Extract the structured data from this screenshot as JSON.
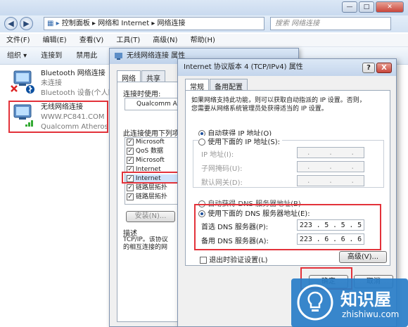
{
  "explorer": {
    "address": {
      "segments": [
        "控制面板",
        "网络和 Internet",
        "网络连接"
      ],
      "separator": "▸"
    },
    "search_placeholder": "搜索 网络连接",
    "menu": [
      "文件(F)",
      "编辑(E)",
      "查看(V)",
      "工具(T)",
      "高级(N)",
      "帮助(H)"
    ],
    "toolbar": [
      "组织 ▾",
      "连接到",
      "禁用此"
    ],
    "connections": [
      {
        "name": "Bluetooth 网络连接",
        "status": "未连接",
        "adapter": "Bluetooth 设备(个人区"
      },
      {
        "name": "无线网络连接",
        "status": "WWW.PC841.COM",
        "adapter": "Qualcomm Atheros A"
      }
    ]
  },
  "dlg1": {
    "title": "无线网络连接 属性",
    "tabs": [
      "网络",
      "共享"
    ],
    "connect_using_label": "连接时使用:",
    "adapter_value": "Qualcomm At",
    "items_label": "此连接使用下列项",
    "items": [
      "Microsoft",
      "QoS 数据",
      "Microsoft",
      "Internet",
      "Internet",
      "链路层拓扑",
      "链路层拓扑"
    ],
    "install_btn": "安装(N)...",
    "desc_label": "描述",
    "desc_text": "TCP/IP。该协议\n的相互连接的网"
  },
  "dlg2": {
    "title": "Internet 协议版本 4 (TCP/IPv4) 属性",
    "help": "?",
    "close": "X",
    "tabs": [
      "常规",
      "备用配置"
    ],
    "intro": "如果网络支持此功能，则可以获取自动指派的 IP 设置。否则，\n您需要从网络系统管理员处获得适当的 IP 设置。",
    "auto_ip": "自动获得 IP 地址(O)",
    "manual_ip": "使用下面的 IP 地址(S):",
    "ip_label": "IP 地址(I):",
    "mask_label": "子网掩码(U):",
    "gw_label": "默认网关(D):",
    "auto_dns": "自动获得 DNS 服务器地址(B)",
    "manual_dns": "使用下面的 DNS 服务器地址(E):",
    "pref_dns_label": "首选 DNS 服务器(P):",
    "alt_dns_label": "备用 DNS 服务器(A):",
    "pref_dns": [
      "223",
      "5",
      "5",
      "5"
    ],
    "alt_dns": [
      "223",
      "6",
      "6",
      "6"
    ],
    "validate": "退出时验证设置(L)",
    "advanced": "高级(V)...",
    "ok": "确定",
    "cancel": "取消"
  },
  "watermark": {
    "title": "知识屋",
    "url": "zhishiwu.com"
  }
}
